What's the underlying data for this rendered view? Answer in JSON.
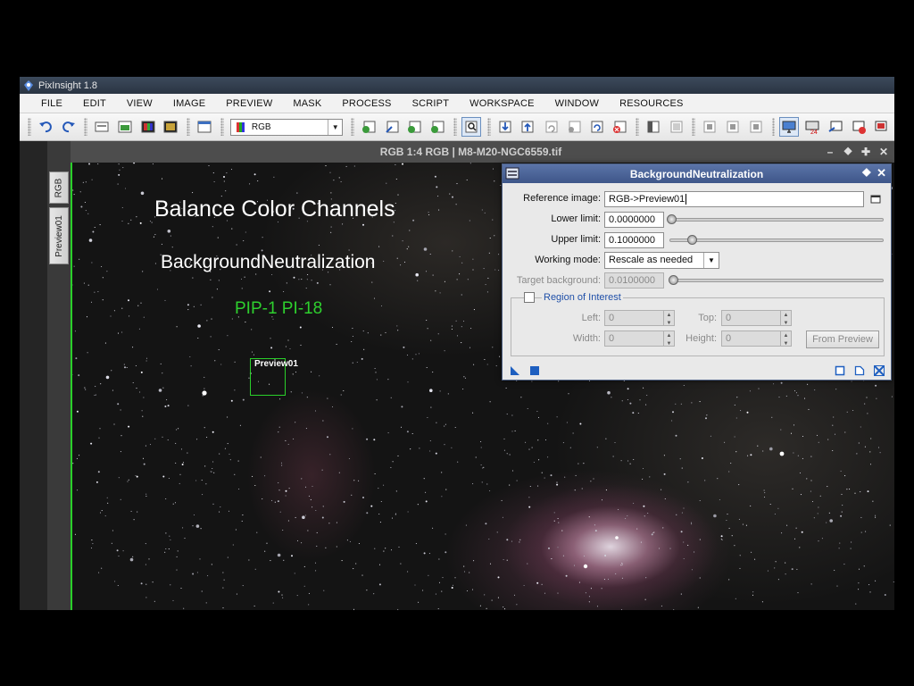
{
  "window": {
    "title": "PixInsight 1.8"
  },
  "menu": [
    "FILE",
    "EDIT",
    "VIEW",
    "IMAGE",
    "PREVIEW",
    "MASK",
    "PROCESS",
    "SCRIPT",
    "WORKSPACE",
    "WINDOW",
    "RESOURCES"
  ],
  "toolbar": {
    "view_select_value": "RGB"
  },
  "image_window": {
    "title": "RGB 1:4 RGB | M8-M20-NGC6559.tif",
    "side_tabs": [
      "RGB",
      "Preview01"
    ],
    "preview_label": "Preview01"
  },
  "overlay": {
    "line1": "Balance Color Channels",
    "line2": "BackgroundNeutralization",
    "line3": "PIP-1 PI-18",
    "line3_color": "#2ed02e"
  },
  "bn_dialog": {
    "title": "BackgroundNeutralization",
    "ref_image": {
      "label": "Reference image:",
      "value": "RGB->Preview01"
    },
    "lower_limit": {
      "label": "Lower limit:",
      "value": "0.0000000",
      "slider_fraction": 0.0
    },
    "upper_limit": {
      "label": "Upper limit:",
      "value": "0.1000000",
      "slider_fraction": 0.1
    },
    "working_mode": {
      "label": "Working mode:",
      "value": "Rescale as needed"
    },
    "target_background": {
      "label": "Target background:",
      "value": "0.0100000",
      "slider_fraction": 0.01
    },
    "roi": {
      "title": "Region of Interest",
      "checked": false,
      "left": {
        "label": "Left:",
        "value": "0"
      },
      "top": {
        "label": "Top:",
        "value": "0"
      },
      "width": {
        "label": "Width:",
        "value": "0"
      },
      "height": {
        "label": "Height:",
        "value": "0"
      },
      "from_preview": "From Preview"
    }
  },
  "colors": {
    "dialog_title": "#4a64a0",
    "preview_border": "#2ad02a",
    "accent_green": "#2ed02e"
  }
}
